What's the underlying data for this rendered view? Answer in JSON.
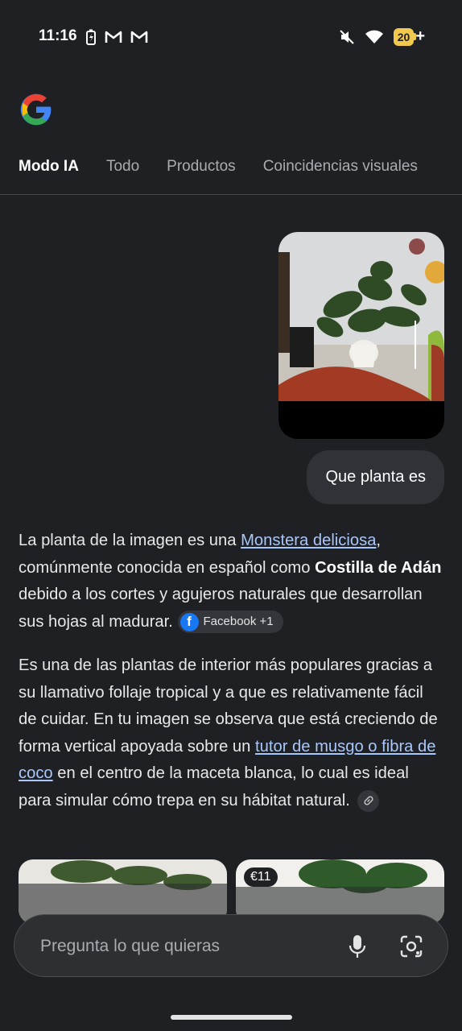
{
  "status": {
    "time": "11:16",
    "battery_level": "20",
    "battery_plus": "+"
  },
  "tabs": [
    {
      "label": "Modo IA",
      "active": true
    },
    {
      "label": "Todo",
      "active": false
    },
    {
      "label": "Productos",
      "active": false
    },
    {
      "label": "Coincidencias visuales",
      "active": false
    }
  ],
  "user_message": "Que planta es",
  "answer": {
    "p1": {
      "t1": "La planta de la imagen es una ",
      "link": "Monstera deliciosa",
      "t2": ", comúnmente conocida en español como ",
      "bold1": "Costilla de Adán",
      "t3": " debido a los cortes y agujeros naturales que desarrollan sus hojas al madurar.",
      "source": "Facebook +1"
    },
    "p2": {
      "t1": "Es una de las plantas de interior más populares gracias a su llamativo follaje tropical y a que es relativamente fácil de cuidar. En tu imagen se observa que está creciendo de forma vertical apoyada sobre un ",
      "link": "tutor de musgo o fibra de coco",
      "t2": " en el centro de la maceta blanca, lo cual es ideal para simular cómo trepa en su hábitat natural."
    }
  },
  "products": [
    {
      "price": ""
    },
    {
      "price": "€11"
    }
  ],
  "input": {
    "placeholder": "Pregunta lo que quieras"
  },
  "icons": {
    "mic": "microphone-icon",
    "lens": "google-lens-icon",
    "facebook": "facebook-icon",
    "link": "link-icon"
  }
}
